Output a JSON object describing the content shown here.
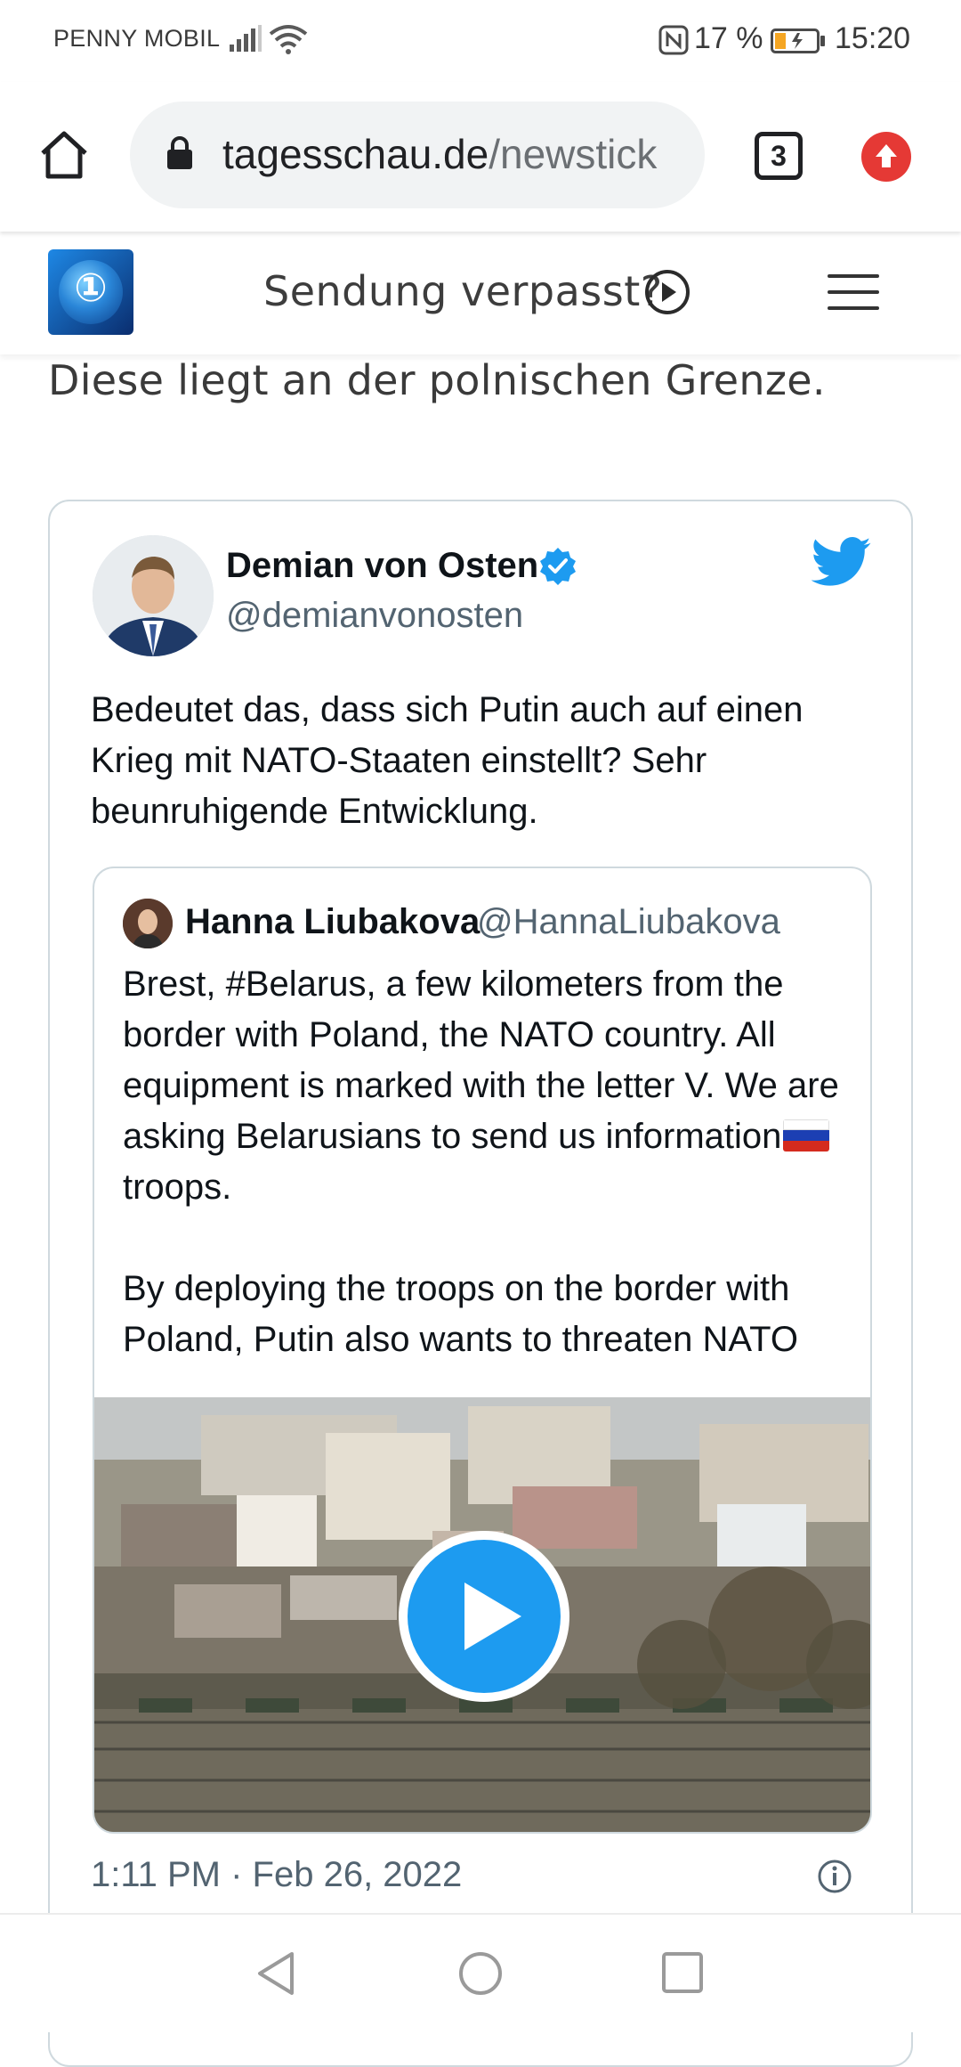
{
  "status_bar": {
    "carrier": "PENNY MOBIL",
    "battery_percent": "17 %",
    "time": "15:20"
  },
  "browser": {
    "url_host": "tagesschau.de",
    "url_path": "/newstick",
    "tab_count": "3"
  },
  "site_header": {
    "missed_show_label": "Sendung verpasst?"
  },
  "article": {
    "text_fragment": "Diese liegt an der polnischen Grenze."
  },
  "tweet": {
    "author_name": "Demian von Osten",
    "author_handle": "@demianvonosten",
    "text": "Bedeutet das, dass sich Putin auch auf einen Krieg mit NATO-Staaten einstellt? Sehr beunruhigende Entwicklung.",
    "timestamp": "1:11 PM · Feb 26, 2022",
    "quoted": {
      "author_name": "Hanna Liubakova",
      "author_handle": "@HannaLiubakova",
      "text_before_flag": "Brest, #Belarus, a few kilometers from the border with Poland, the NATO country. All equipment is marked with the letter V. We are asking Belarusians to send us information",
      "text_after_flag": " troops.",
      "text_paragraph_2": "By deploying the troops on the border with Poland, Putin also wants to threaten NATO"
    }
  },
  "colors": {
    "twitter_blue": "#1d9bf0",
    "update_red": "#e53935",
    "tagesschau_blue": "#0a3a86"
  },
  "icons": {
    "home": "home-icon",
    "lock": "lock-icon",
    "menu": "hamburger-menu-icon",
    "play": "play-icon",
    "verified": "verified-badge-icon",
    "twitter": "twitter-bird-icon",
    "info": "info-icon"
  }
}
